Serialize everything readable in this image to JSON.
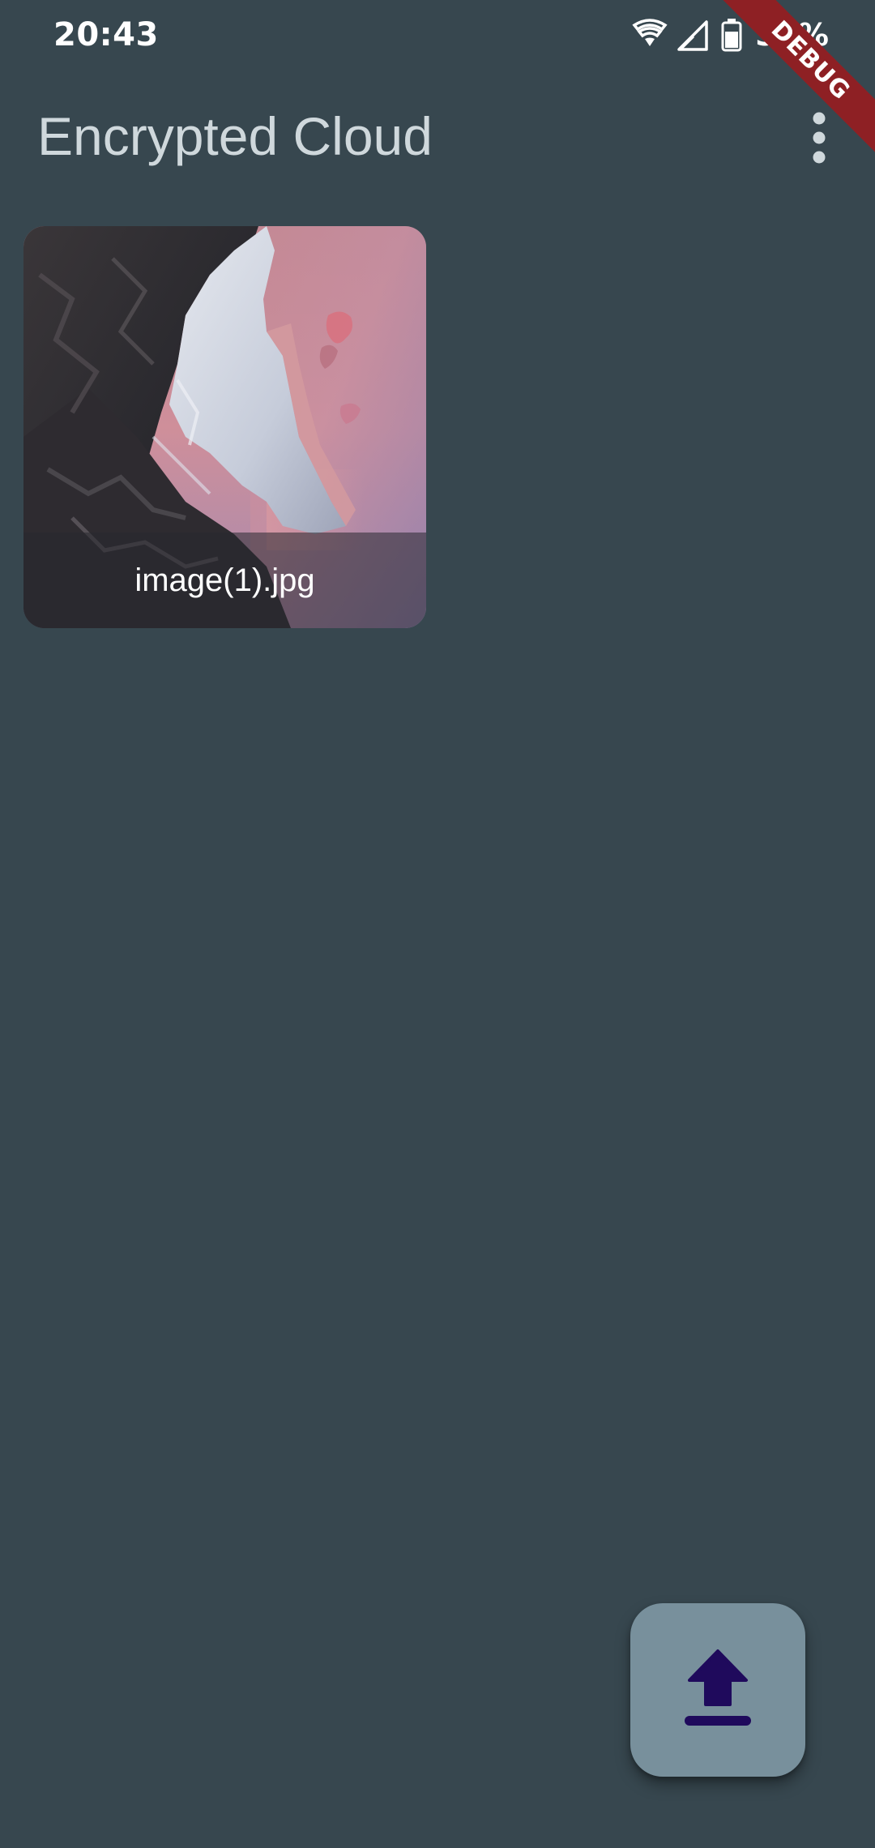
{
  "status_bar": {
    "time": "20:43",
    "battery_percent": "57%",
    "icons": [
      "wifi-icon",
      "signal-icon",
      "battery-icon"
    ]
  },
  "debug_banner": {
    "label": "DEBUG",
    "color": "#8e2024"
  },
  "app_bar": {
    "title": "Encrypted Cloud",
    "menu_icon": "more-vert-icon"
  },
  "files": [
    {
      "name": "image(1).jpg",
      "thumbnail": "mountain-sunset-image"
    }
  ],
  "fab": {
    "icon": "upload-icon",
    "background": "#78909c",
    "icon_color": "#1f0a5c"
  },
  "colors": {
    "background": "#37474f",
    "title": "#cfd8dc"
  }
}
